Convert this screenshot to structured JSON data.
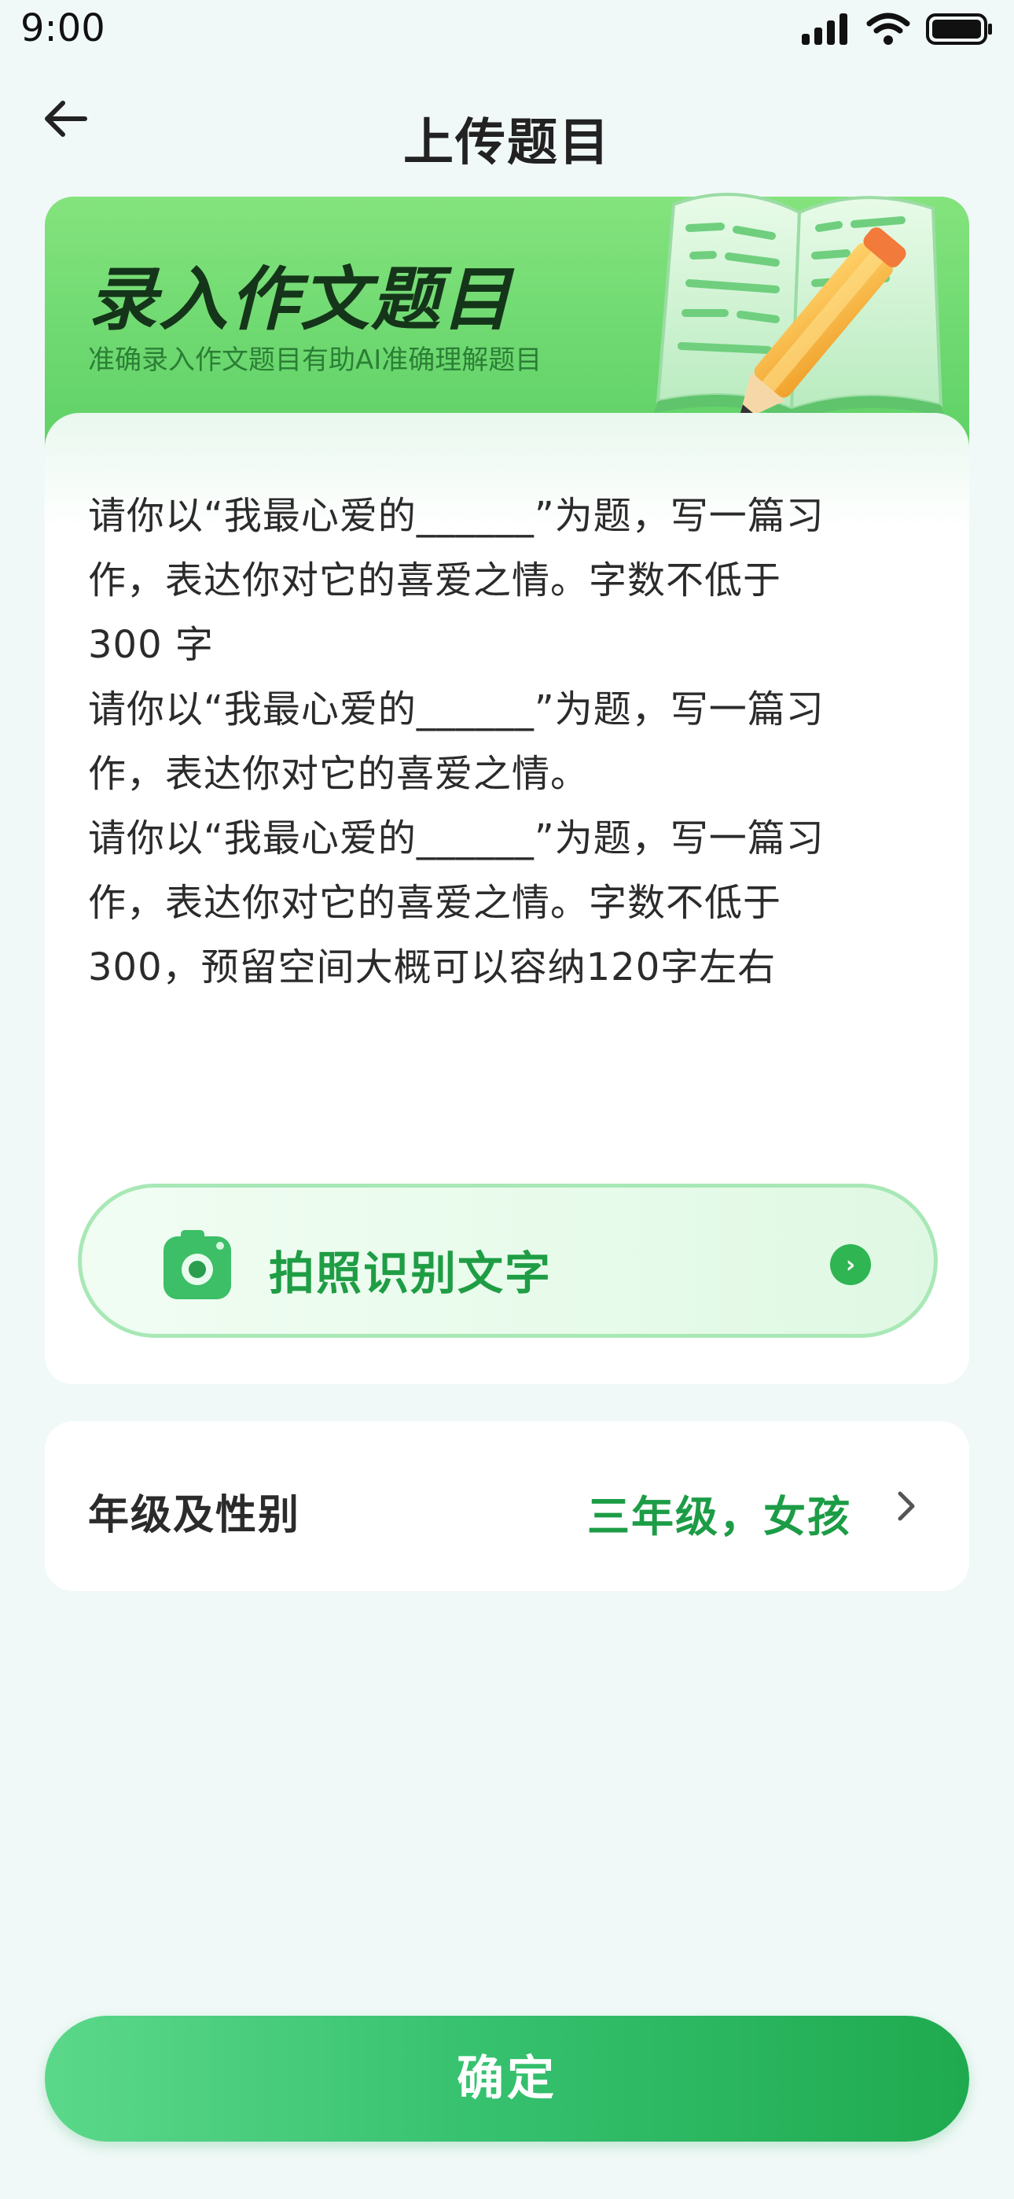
{
  "status_bar": {
    "time": "9:00"
  },
  "nav": {
    "title": "上传题目"
  },
  "card": {
    "title": "录入作文题目",
    "subtitle": "准确录入作文题目有助AI准确理解题目",
    "essay_lines": [
      "请你以“我最心爱的______”为题，写一篇习",
      "作，表达你对它的喜爱之情。字数不低于",
      "300 字",
      "请你以“我最心爱的______”为题，写一篇习",
      "作，表达你对它的喜爱之情。",
      "请你以“我最心爱的______”为题，写一篇习",
      "作，表达你对它的喜爱之情。字数不低于",
      "300，预留空间大概可以容纳120字左右"
    ],
    "photo_button_label": "拍照识别文字"
  },
  "grade": {
    "label": "年级及性别",
    "value": "三年级，女孩"
  },
  "confirm_label": "确定",
  "colors": {
    "accent": "#1f9d45",
    "background": "#f1f9f8",
    "header_green": "#62d56a"
  },
  "icons": [
    "back-arrow-icon",
    "signal-icon",
    "wifi-icon",
    "battery-icon",
    "book-pencil-illustration",
    "camera-icon",
    "chevron-right-icon"
  ]
}
